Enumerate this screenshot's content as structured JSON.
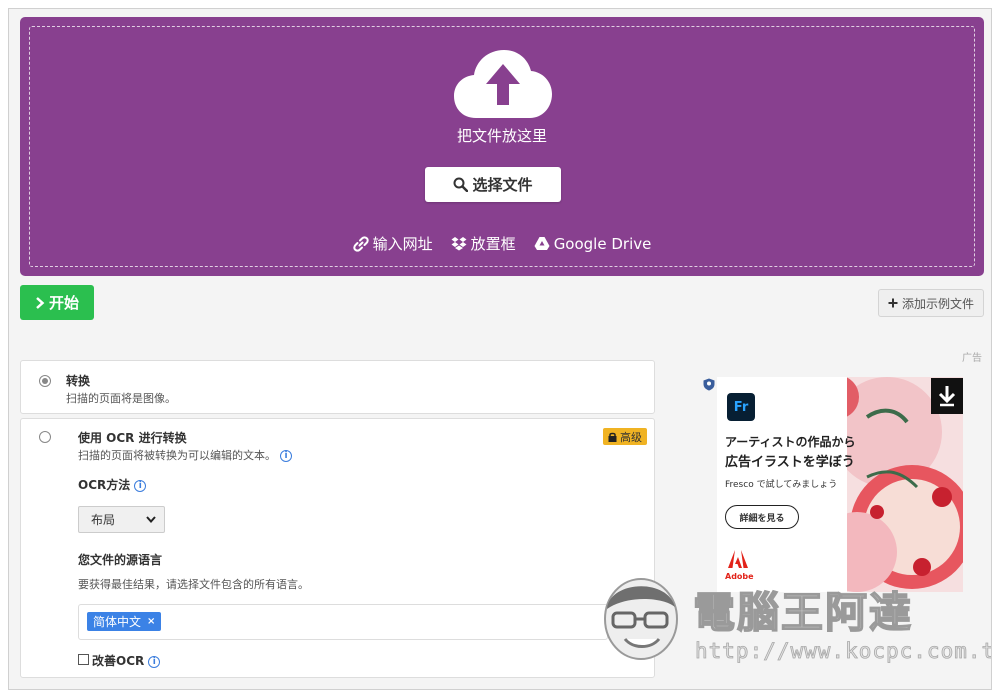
{
  "dropzone": {
    "drop_text": "把文件放这里",
    "choose_label": "选择文件",
    "sources": [
      {
        "label": "输入网址",
        "icon": "link-icon"
      },
      {
        "label": "放置框",
        "icon": "dropbox-icon"
      },
      {
        "label": "Google Drive",
        "icon": "google-drive-icon"
      }
    ],
    "color": "#88408f"
  },
  "toolbar": {
    "start_label": "开始",
    "add_sample_label": "添加示例文件",
    "start_color": "#2bbf4f"
  },
  "ad_label": "广告",
  "options": {
    "convert": {
      "title": "转换",
      "desc": "扫描的页面将是图像。",
      "selected": true
    },
    "ocr": {
      "title": "使用 OCR 进行转换",
      "desc": "扫描的页面将被转换为可以编辑的文本。",
      "premium_label": "高级",
      "selected": false,
      "method_label": "OCR方法",
      "method_value": "布局",
      "lang_label": "您文件的源语言",
      "lang_desc": "要获得最佳结果，请选择文件包含的所有语言。",
      "lang_tag": "简体中文",
      "improve_label": "改善OCR"
    }
  },
  "ad": {
    "brand_logo": "Fr",
    "headline1": "アーティストの作品から",
    "headline2": "広告イラストを学ぼう",
    "sub": "Fresco で試してみましょう",
    "cta": "詳細を見る",
    "adobe": "Adobe"
  },
  "watermark": {
    "text": "電腦王阿達",
    "url": "http://www.kocpc.com.tw"
  }
}
